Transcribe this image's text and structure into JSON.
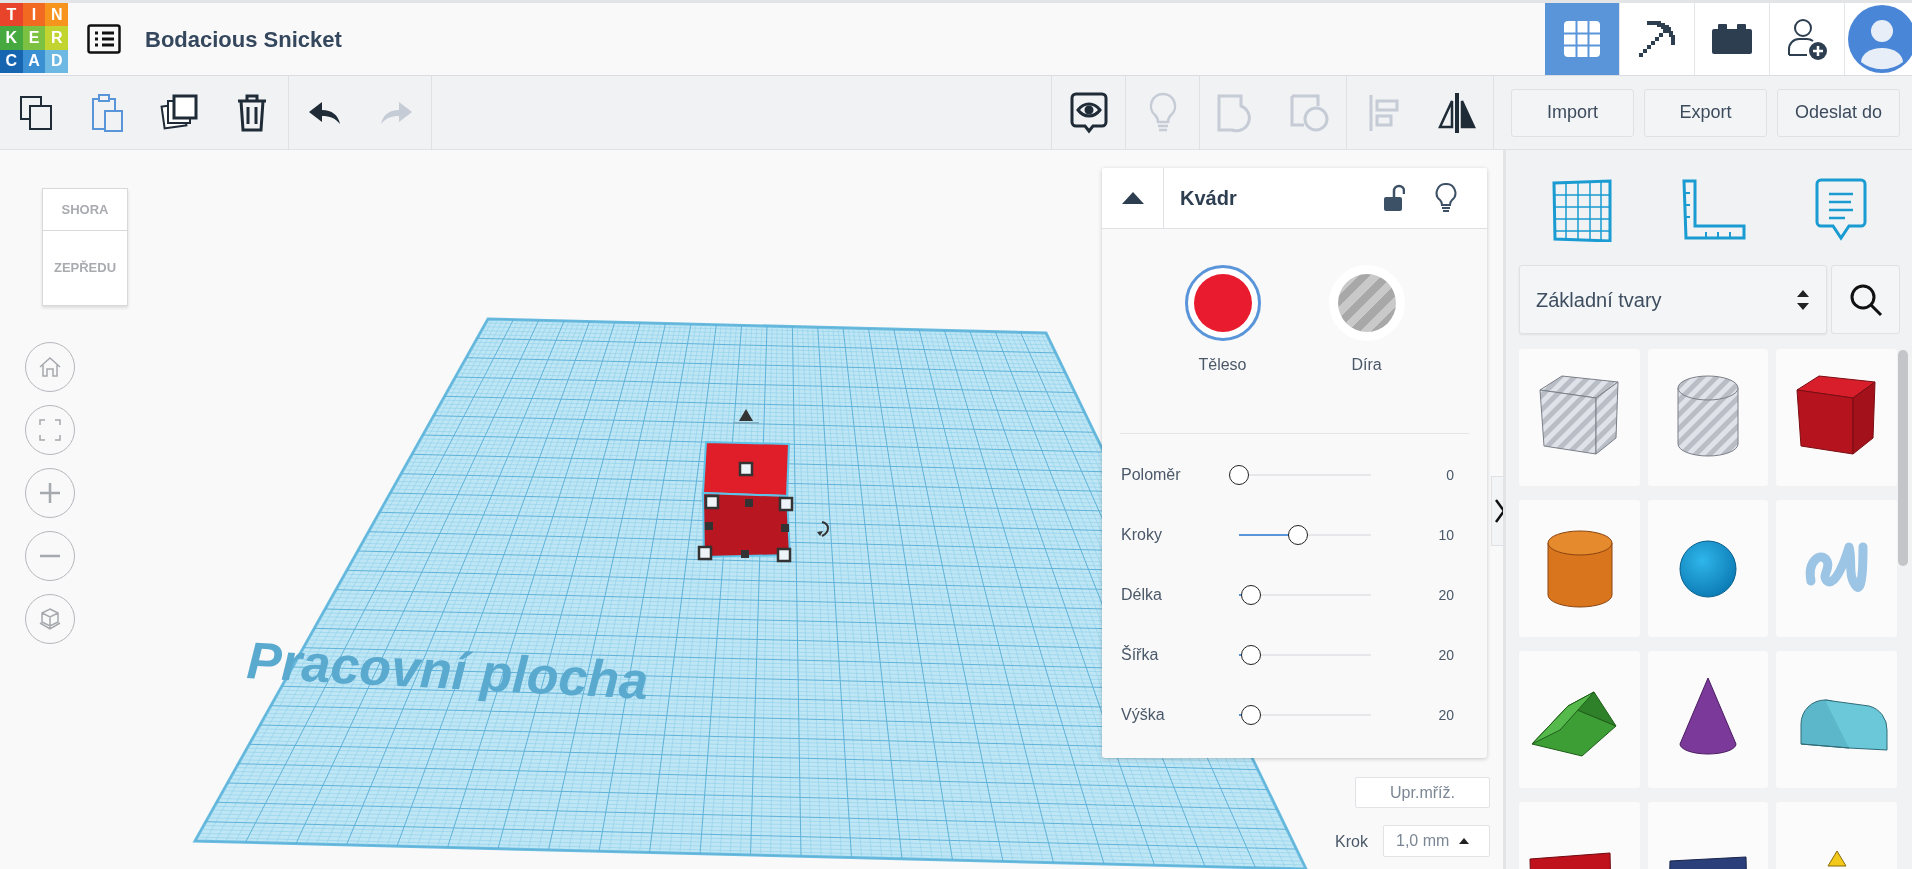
{
  "header": {
    "logo_letters": [
      "T",
      "I",
      "N",
      "K",
      "E",
      "R",
      "C",
      "A",
      "D"
    ],
    "project_title": "Bodacious Snicket",
    "view_tabs": [
      {
        "kind": "grid",
        "selected": true
      },
      {
        "kind": "pickaxe",
        "selected": false
      },
      {
        "kind": "bricks",
        "selected": false
      }
    ]
  },
  "toolbar": {
    "edit_tools": [
      {
        "kind": "copy",
        "disabled": false
      },
      {
        "kind": "paste",
        "disabled": false
      },
      {
        "kind": "duplicate",
        "disabled": false
      },
      {
        "kind": "delete",
        "disabled": false
      }
    ],
    "history_tools": [
      {
        "kind": "undo",
        "disabled": false
      },
      {
        "kind": "redo",
        "disabled": true
      }
    ],
    "view_tools": [
      {
        "kind": "notes",
        "disabled": false
      },
      {
        "kind": "bulb",
        "disabled": true
      },
      {
        "kind": "group",
        "disabled": true
      },
      {
        "kind": "subtract",
        "disabled": true
      },
      {
        "kind": "align",
        "disabled": true
      },
      {
        "kind": "mirror",
        "disabled": false
      }
    ],
    "buttons": [
      "Import",
      "Export",
      "Odeslat do"
    ]
  },
  "view_cube": {
    "top_face": "SHORA",
    "front_face": "ZEPŘEDU"
  },
  "nav_buttons": [
    {
      "kind": "home"
    },
    {
      "kind": "fit"
    },
    {
      "kind": "zoom-in"
    },
    {
      "kind": "zoom-out"
    },
    {
      "kind": "perspective"
    }
  ],
  "workplane": {
    "label": "Pracovní plocha"
  },
  "inspector": {
    "title": "Kvádr",
    "locked": false,
    "modes": [
      {
        "kind": "solid",
        "label": "Těleso",
        "selected": true
      },
      {
        "kind": "hole",
        "label": "Díra",
        "selected": false
      }
    ],
    "params": [
      {
        "name": "Poloměr",
        "level": 0,
        "value": "0"
      },
      {
        "name": "Kroky",
        "level": 0.45,
        "value": "10"
      },
      {
        "name": "Délka",
        "level": 0.09,
        "value": "20"
      },
      {
        "name": "Šířka",
        "level": 0.09,
        "value": "20"
      },
      {
        "name": "Výška",
        "level": 0.09,
        "value": "20"
      }
    ]
  },
  "grid_settings": {
    "edit_grid": "Upr.mříž.",
    "step_label": "Krok",
    "step_value": "1,0 mm"
  },
  "shapes_panel": {
    "tools": [
      {
        "kind": "workplane"
      },
      {
        "kind": "ruler"
      },
      {
        "kind": "notes"
      }
    ],
    "category": "Základní tvary",
    "shapes": [
      {
        "kind": "box-hole"
      },
      {
        "kind": "cylinder-hole"
      },
      {
        "kind": "box"
      },
      {
        "kind": "cylinder"
      },
      {
        "kind": "sphere"
      },
      {
        "kind": "scribble"
      },
      {
        "kind": "roof"
      },
      {
        "kind": "cone"
      },
      {
        "kind": "round-roof"
      },
      {
        "kind": "text-block"
      },
      {
        "kind": "slab"
      },
      {
        "kind": "pyramid"
      }
    ]
  }
}
